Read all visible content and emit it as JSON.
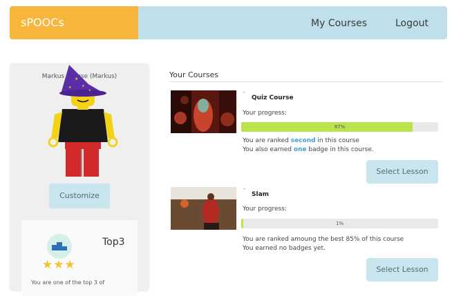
{
  "nav": {
    "brand": "sPOOCs",
    "my_courses": "My Courses",
    "logout": "Logout"
  },
  "profile": {
    "username": "Markus Krause (Markus)",
    "customize_label": "Customize"
  },
  "badge": {
    "title": "Top3",
    "stars": "★★★",
    "description": "You are one of the top 3 of"
  },
  "courses_heading": "Your Courses",
  "courses": [
    {
      "name": "Quiz Course",
      "progress_label": "Your progress:",
      "progress": 87,
      "progress_text": "87%",
      "rank_prefix": "You are ranked ",
      "rank_highlight": "second",
      "rank_suffix": " in this course",
      "badge_prefix": "You also earned ",
      "badge_highlight": "one",
      "badge_suffix": " badge in this course.",
      "button": "Select Lesson"
    },
    {
      "name": "Slam",
      "progress_label": "Your progress:",
      "progress": 1,
      "progress_text": "1%",
      "rank_text": "You are ranked amoung the best 85% of this course",
      "badge_text": "You earned no badges yet.",
      "button": "Select Lesson"
    }
  ],
  "colors": {
    "brand_bg": "#f8b73c",
    "nav_bg": "#bfe0ea",
    "progress_fill": "#b9e34f",
    "highlight": "#3f9fdc"
  }
}
